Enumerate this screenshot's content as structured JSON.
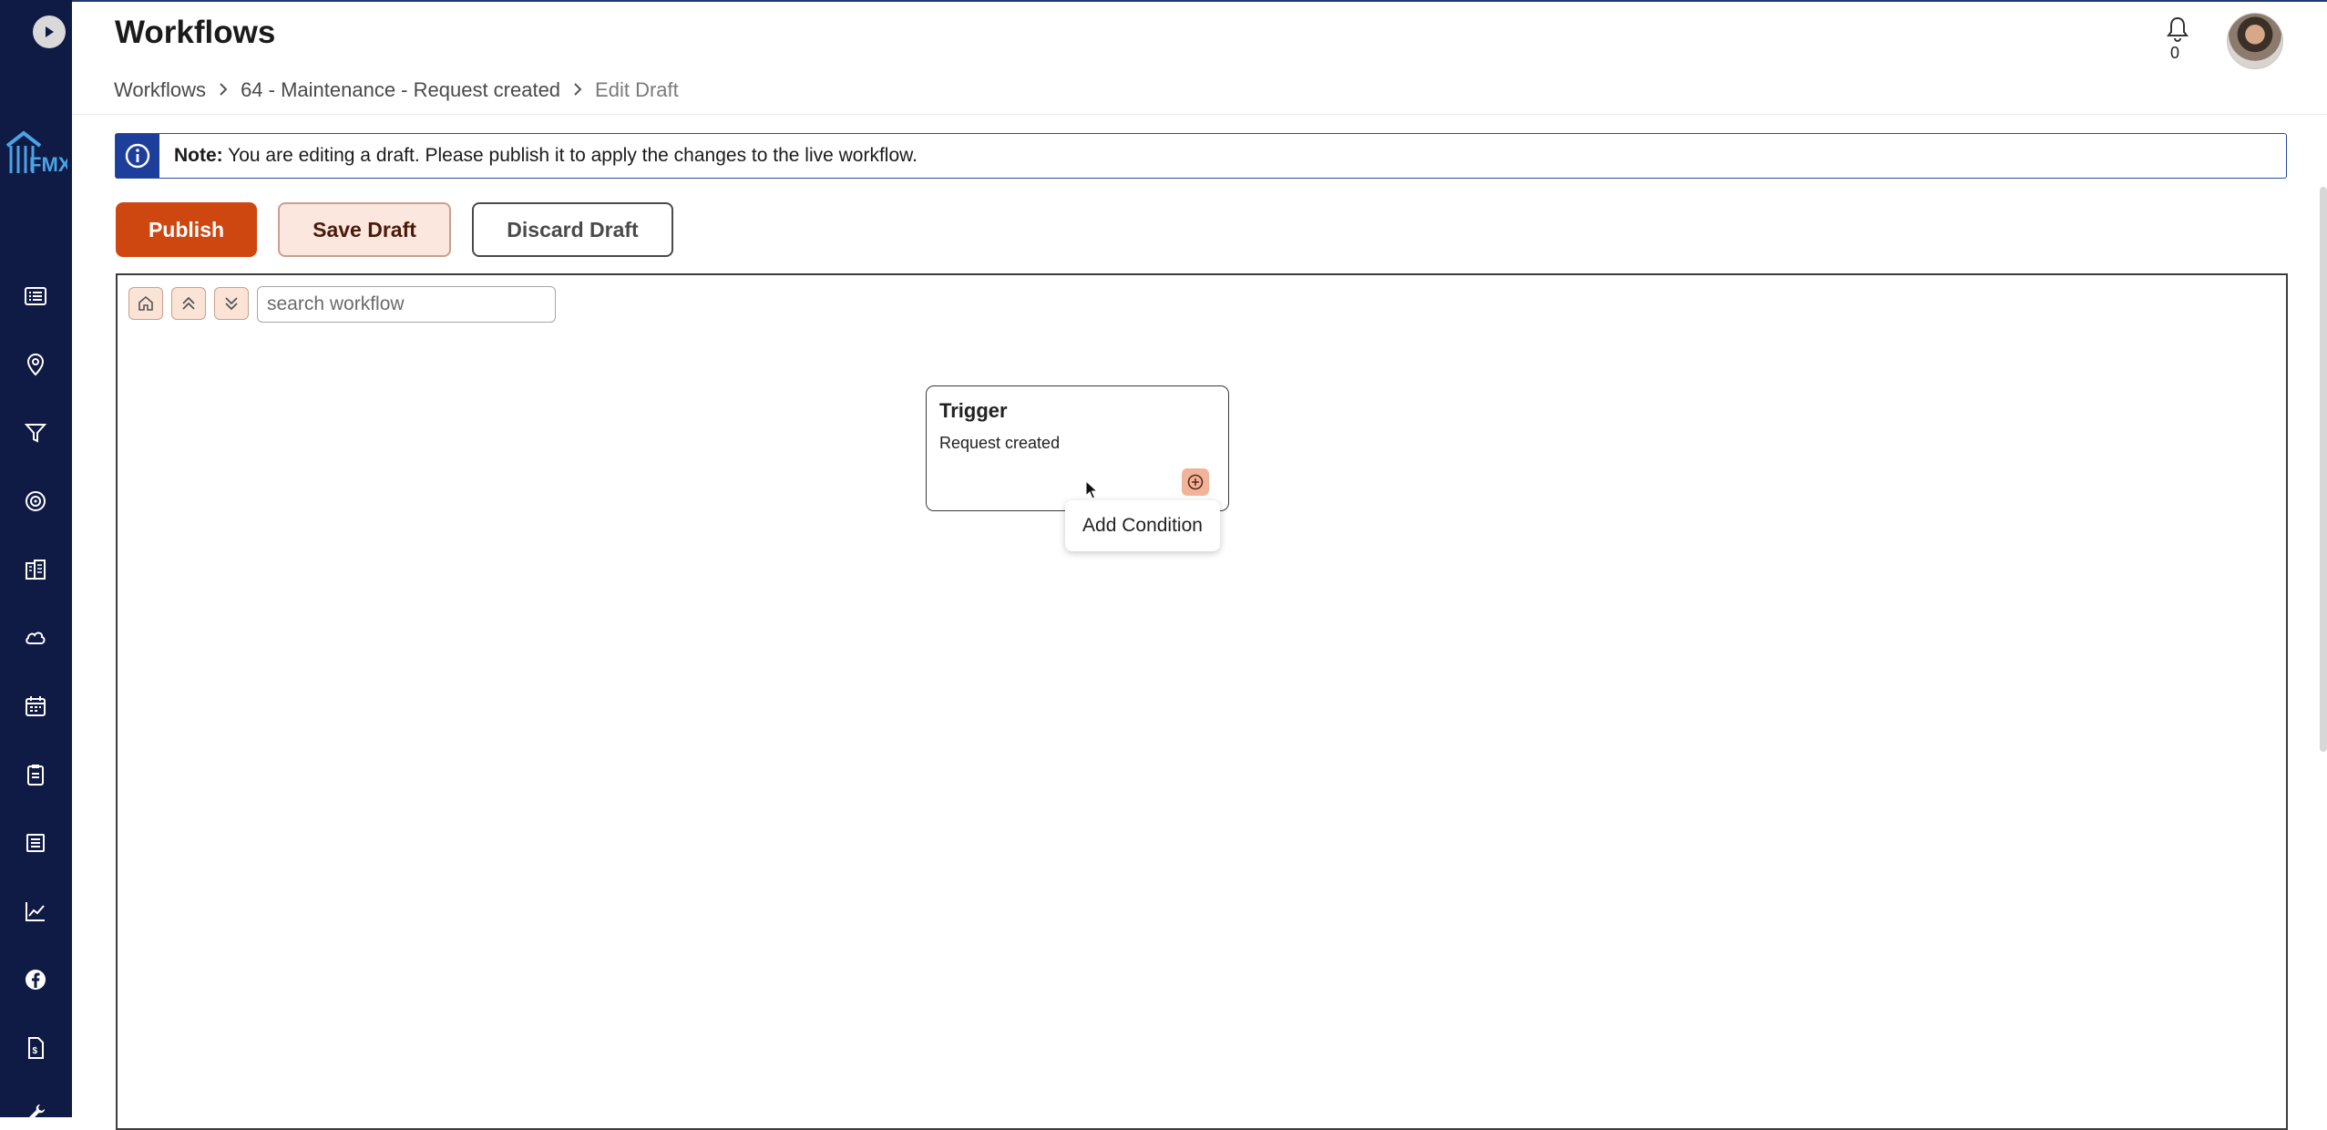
{
  "app": {
    "title": "Workflows",
    "accent_color": "#cf4710",
    "sidebar_color": "#0f1b44"
  },
  "breadcrumb": [
    {
      "label": "Workflows"
    },
    {
      "label": "64 - Maintenance - Request created"
    },
    {
      "label": "Edit Draft"
    }
  ],
  "header": {
    "notification_icon": "bell-icon",
    "notification_count": "0",
    "avatar": "user-avatar"
  },
  "sidebar": {
    "toggle_icon": "play-circle-icon",
    "logo": "fmx-logo",
    "items": [
      {
        "icon": "list-icon"
      },
      {
        "icon": "location-pin-icon"
      },
      {
        "icon": "filter-icon"
      },
      {
        "icon": "target-icon"
      },
      {
        "icon": "buildings-icon"
      },
      {
        "icon": "cloud-icon"
      },
      {
        "icon": "calendar-icon"
      },
      {
        "icon": "clipboard-icon"
      },
      {
        "icon": "table-icon"
      },
      {
        "icon": "chart-line-icon"
      },
      {
        "icon": "facebook-icon"
      },
      {
        "icon": "invoice-icon"
      },
      {
        "icon": "wrench-icon"
      }
    ]
  },
  "note": {
    "prefix": "Note:",
    "text": " You are editing a draft. Please publish it to apply the changes to the live workflow."
  },
  "actions": {
    "publish": "Publish",
    "save_draft": "Save Draft",
    "discard_draft": "Discard Draft"
  },
  "canvas": {
    "search_placeholder": "search workflow",
    "toolbar": [
      "home-icon",
      "collapse-all-icon",
      "expand-all-icon"
    ],
    "node": {
      "title": "Trigger",
      "subtitle": "Request created"
    },
    "tooltip": "Add Condition"
  }
}
